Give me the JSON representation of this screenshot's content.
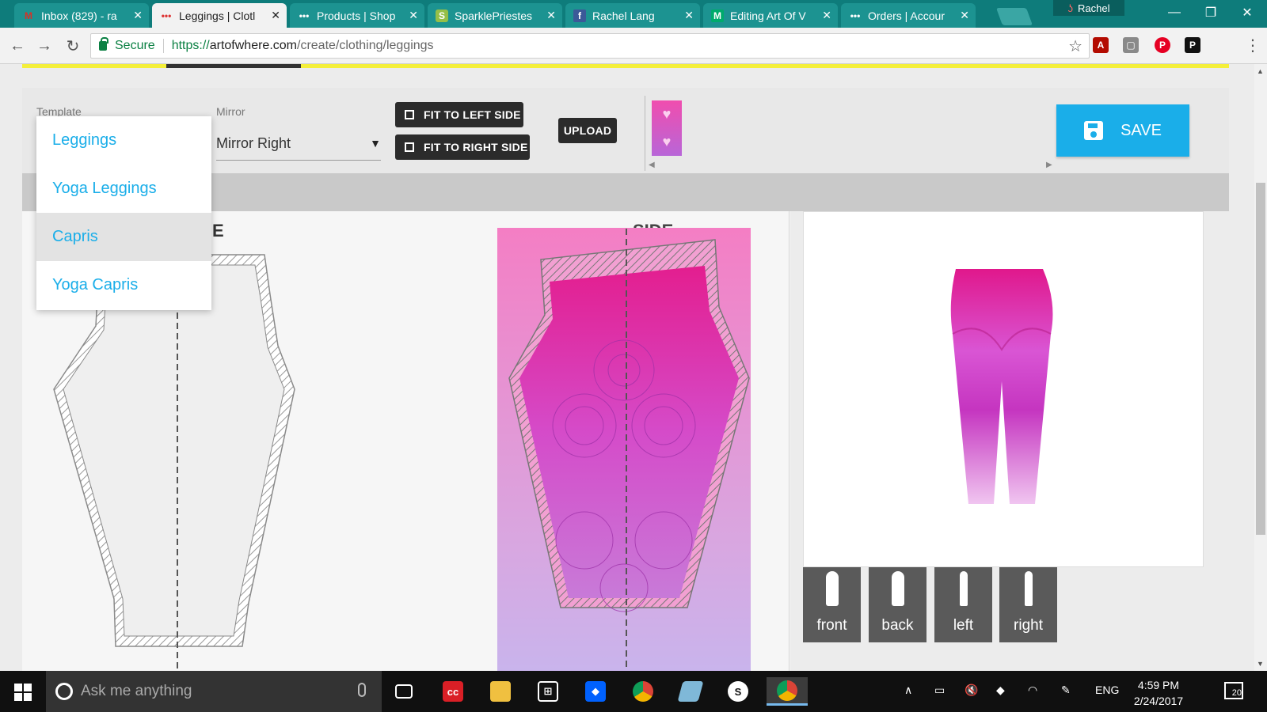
{
  "browser": {
    "tabs": [
      {
        "title": "Inbox (829) - ra",
        "favicon": "gmail-icon",
        "active": false
      },
      {
        "title": "Leggings | Clotl",
        "favicon": "artofwhere-icon",
        "active": true
      },
      {
        "title": "Products | Shop",
        "favicon": "artofwhere-icon",
        "active": false
      },
      {
        "title": "SparklePriestes",
        "favicon": "shopify-icon",
        "active": false
      },
      {
        "title": "Rachel Lang",
        "favicon": "facebook-icon",
        "active": false
      },
      {
        "title": "Editing Art Of V",
        "favicon": "medium-icon",
        "active": false
      },
      {
        "title": "Orders | Accour",
        "favicon": "artofwhere-icon",
        "active": false
      }
    ],
    "profile_name": "Rachel",
    "secure_label": "Secure",
    "url_protocol": "https://",
    "url_host": "artofwhere.com",
    "url_path": "/create/clothing/leggings"
  },
  "editor": {
    "template_label": "Template",
    "mirror_label": "Mirror",
    "mirror_value": "Mirror Right",
    "fit_left_label": "FIT TO LEFT SIDE",
    "fit_right_label": "FIT TO RIGHT SIDE",
    "upload_label": "UPLOAD",
    "save_label": "SAVE",
    "template_options": [
      "Leggings",
      "Yoga Leggings",
      "Capris",
      "Yoga Capris"
    ],
    "template_selected": "Capris",
    "side_label_left": "E",
    "side_label_right": "SIDE",
    "accent_color": "#1aaee9",
    "art_colors": [
      "#f47ec4",
      "#e31e8f",
      "#c06ad6"
    ]
  },
  "preview": {
    "views": [
      "front",
      "back",
      "left",
      "right"
    ]
  },
  "taskbar": {
    "search_placeholder": "Ask me anything",
    "language": "ENG",
    "time": "4:59 PM",
    "date": "2/24/2017",
    "notification_count": "20"
  }
}
